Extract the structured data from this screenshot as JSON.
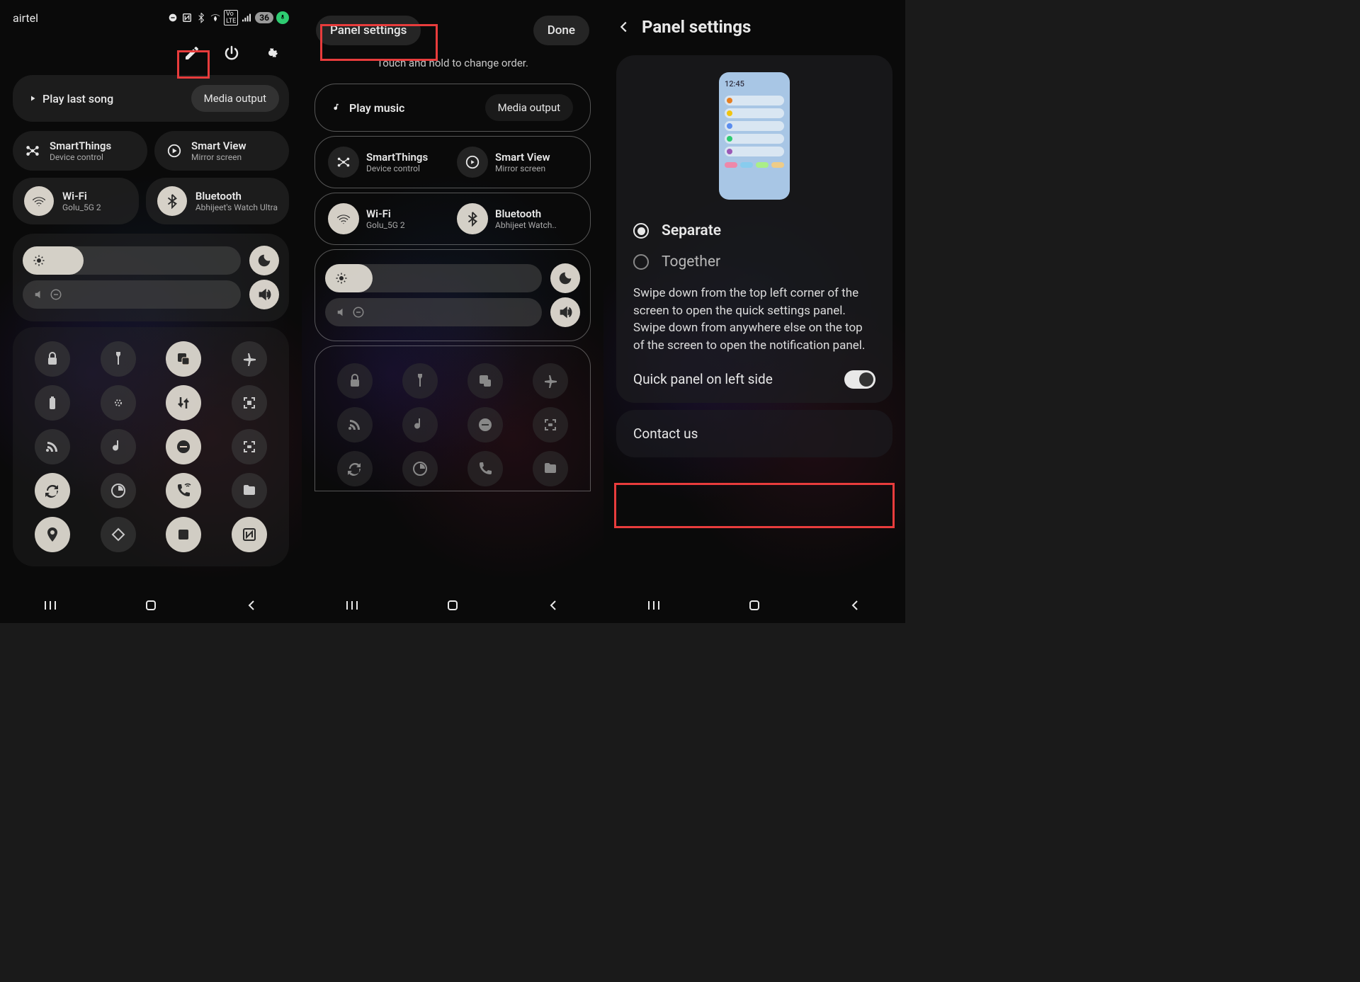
{
  "panel1": {
    "carrier": "airtel",
    "battery": "36",
    "play_last": "Play last song",
    "media_output": "Media output",
    "smartthings": {
      "title": "SmartThings",
      "sub": "Device control"
    },
    "smartview": {
      "title": "Smart View",
      "sub": "Mirror screen"
    },
    "wifi": {
      "title": "Wi-Fi",
      "sub": "Golu_5G 2"
    },
    "bluetooth": {
      "title": "Bluetooth",
      "sub": "Abhijeet's Watch Ultra"
    }
  },
  "panel2": {
    "settings_btn": "Panel settings",
    "done": "Done",
    "subtitle": "Touch and hold to change order.",
    "play_music": "Play music",
    "media_output": "Media output",
    "smartthings": {
      "title": "SmartThings",
      "sub": "Device control"
    },
    "smartview": {
      "title": "Smart View",
      "sub": "Mirror screen"
    },
    "wifi": {
      "title": "Wi-Fi",
      "sub": "Golu_5G 2"
    },
    "bluetooth": {
      "title": "Bluetooth",
      "sub": "Abhijeet Watch.."
    }
  },
  "panel3": {
    "title": "Panel settings",
    "preview_time": "12:45",
    "separate": "Separate",
    "together": "Together",
    "description": "Swipe down from the top left corner of the screen to open the quick settings panel. Swipe down from anywhere else on the top of the screen to open the notification panel.",
    "quick_left": "Quick panel on left side",
    "contact": "Contact us"
  }
}
